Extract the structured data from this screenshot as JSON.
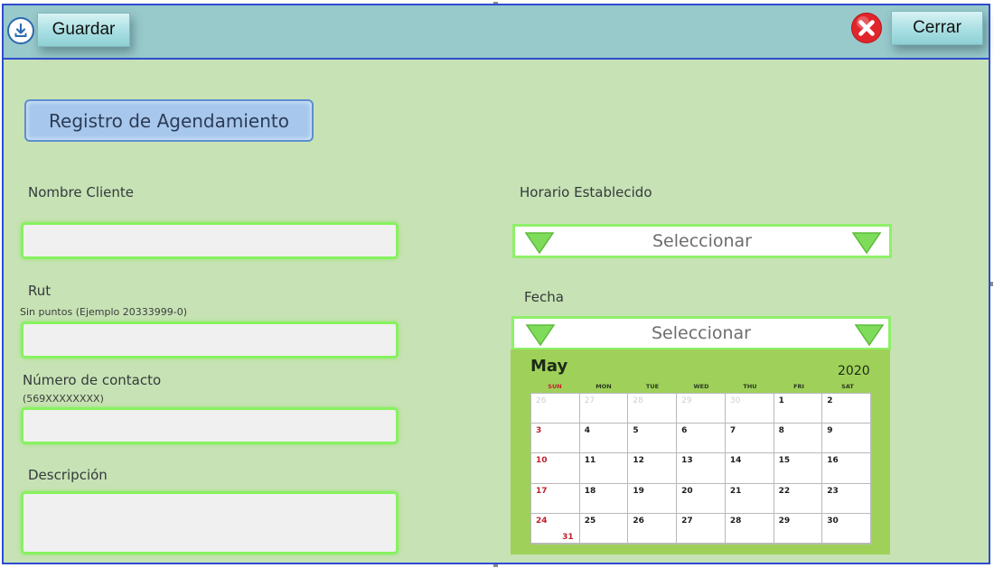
{
  "toolbar": {
    "save_label": "Guardar",
    "close_label": "Cerrar",
    "save_icon": "download-icon",
    "close_icon": "close-x-icon",
    "close_icon_color": "#e0252b"
  },
  "form": {
    "title": "Registro de Agendamiento",
    "client_name_label": "Nombre Cliente",
    "rut_label": "Rut",
    "rut_hint": "Sin puntos (Ejemplo 20333999-0)",
    "contact_label": "Número de contacto",
    "contact_hint": "(569XXXXXXXX)",
    "description_label": "Descripción",
    "schedule_label": "Horario Establecido",
    "schedule_value": "Seleccionar",
    "date_label": "Fecha",
    "date_value": "Seleccionar"
  },
  "calendar": {
    "month": "May",
    "year": "2020",
    "weekdays": [
      "SUN",
      "MON",
      "TUE",
      "WED",
      "THU",
      "FRI",
      "SAT"
    ],
    "weeks": [
      [
        {
          "d": "26",
          "muted": true
        },
        {
          "d": "27",
          "muted": true
        },
        {
          "d": "28",
          "muted": true
        },
        {
          "d": "29",
          "muted": true
        },
        {
          "d": "30",
          "muted": true
        },
        {
          "d": "1"
        },
        {
          "d": "2"
        }
      ],
      [
        {
          "d": "3",
          "red": true
        },
        {
          "d": "4"
        },
        {
          "d": "5"
        },
        {
          "d": "6"
        },
        {
          "d": "7"
        },
        {
          "d": "8"
        },
        {
          "d": "9"
        }
      ],
      [
        {
          "d": "10",
          "red": true
        },
        {
          "d": "11"
        },
        {
          "d": "12"
        },
        {
          "d": "13"
        },
        {
          "d": "14"
        },
        {
          "d": "15"
        },
        {
          "d": "16"
        }
      ],
      [
        {
          "d": "17",
          "red": true
        },
        {
          "d": "18"
        },
        {
          "d": "19"
        },
        {
          "d": "20"
        },
        {
          "d": "21"
        },
        {
          "d": "22"
        },
        {
          "d": "23"
        }
      ],
      [
        {
          "d": "24",
          "red": true,
          "extra": "31"
        },
        {
          "d": "25"
        },
        {
          "d": "26"
        },
        {
          "d": "27"
        },
        {
          "d": "28"
        },
        {
          "d": "29"
        },
        {
          "d": "30"
        }
      ]
    ]
  },
  "colors": {
    "background": "#c7e2b4",
    "topbar": "#98c9cb",
    "field_border": "#86f25e",
    "calendar_bg": "#9fd15a",
    "accent_border": "#2f4bd0"
  }
}
